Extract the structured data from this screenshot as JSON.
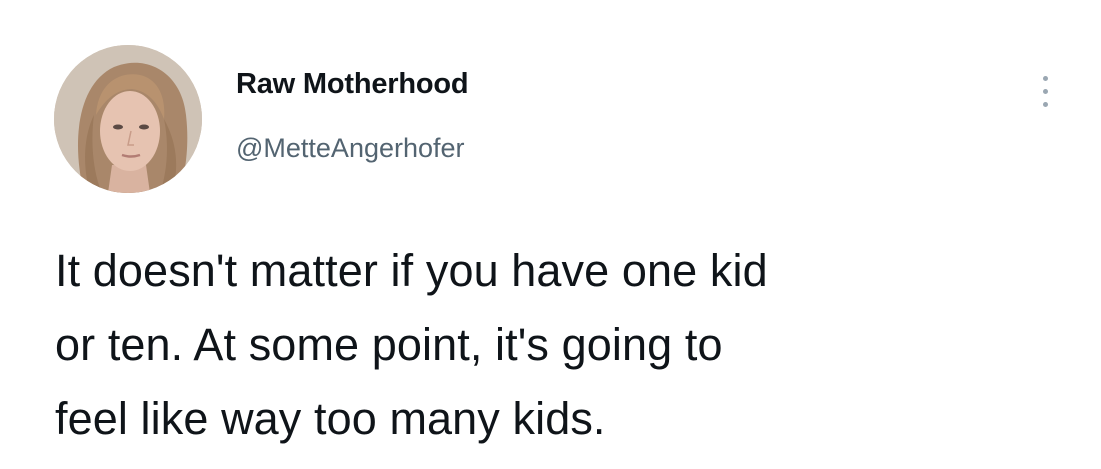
{
  "tweet": {
    "author": {
      "display_name": "Raw Motherhood",
      "handle": "@MetteAngerhofer",
      "avatar_icon": "profile-photo"
    },
    "more_icon": "more-vertical-icon",
    "text_lines": [
      "It doesn't matter if you have one kid",
      "or ten. At some point, it's going to",
      "feel like way too many kids."
    ]
  },
  "colors": {
    "name": "#0f1419",
    "handle": "#536471",
    "more_dots": "#9aa7b2"
  }
}
